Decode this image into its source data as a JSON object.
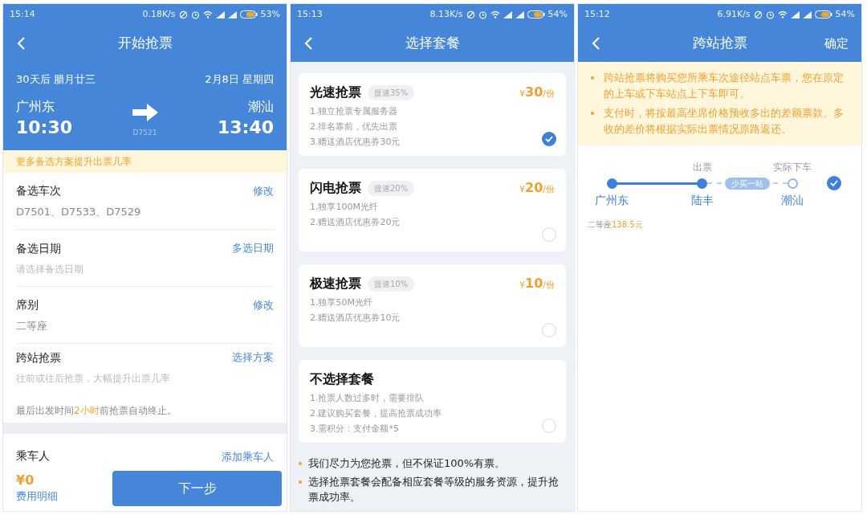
{
  "booking_screen": {
    "status_bar": {
      "time": "15:14",
      "speed": "0.18K/s",
      "battery": "53%"
    },
    "header": {
      "title": "开始抢票"
    },
    "trip": {
      "days_ahead": "30天后 腊月廿三",
      "date": "2月8日 星期四",
      "from": "广州东",
      "depart": "10:30",
      "train": "D7521",
      "to": "潮汕",
      "arrive": "13:40"
    },
    "notice": "更多备选方案提升出票几率",
    "options": [
      {
        "label": "备选车次",
        "action": "修改",
        "value": "D7501、D7533、D7529"
      },
      {
        "label": "备选日期",
        "action": "多选日期",
        "placeholder": "请选择备选日期"
      },
      {
        "label": "席别",
        "action": "修改",
        "value": "二等座"
      },
      {
        "label": "跨站抢票",
        "action": "选择方案",
        "placeholder": "往前或往后抢票，大幅提升出票几率"
      }
    ],
    "deadline_note": "最后出发时间**2小时**前抢票自动终止。",
    "passenger": {
      "label": "乘车人",
      "action": "添加乘车人"
    },
    "footer": {
      "price": "¥0",
      "detail": "费用明细",
      "button": "下一步"
    }
  },
  "package_screen": {
    "status_bar": {
      "time": "15:13",
      "speed": "8.13K/s",
      "battery": "54%"
    },
    "header": {
      "title": "选择套餐"
    },
    "packages": [
      {
        "name": "光速抢票",
        "boost": "提速35%",
        "currency": "¥",
        "amount": "30",
        "unit": "/份",
        "features": [
          "1.独立抢票专属服务器",
          "2.排名靠前，优先出票",
          "3.赠送酒店优惠券30元"
        ],
        "selected": true
      },
      {
        "name": "闪电抢票",
        "boost": "提速20%",
        "currency": "¥",
        "amount": "20",
        "unit": "/份",
        "features": [
          "1.独享100M光纤",
          "2.赠送酒店优惠券20元"
        ],
        "selected": false
      },
      {
        "name": "极速抢票",
        "boost": "提速10%",
        "currency": "¥",
        "amount": "10",
        "unit": "/份",
        "features": [
          "1.独享50M光纤",
          "2.赠送酒店优惠券10元"
        ],
        "selected": false
      },
      {
        "name": "不选择套餐",
        "features": [
          "1.抢票人数过多时，需要排队",
          "2.建议购买套餐，提高抢票成功率",
          "3.需积分：支付金额*5"
        ],
        "selected": false
      }
    ],
    "notes": [
      "我们尽力为您抢票，但不保证100%有票。",
      "选择抢票套餐会配备相应套餐等级的服务资源，提升抢票成功率。"
    ]
  },
  "cross_station_screen": {
    "status_bar": {
      "time": "15:12",
      "speed": "6.91K/s",
      "battery": "54%"
    },
    "header": {
      "title": "跨站抢票",
      "action": "确定"
    },
    "notices": [
      "跨站抢票将购买您所乘车次途径站点车票，您在原定的上车或下车站点上下车即可。",
      "支付时，将按最高坐席价格预收多出的差额票款。多收的差价将根据实际出票情况原路返还。"
    ],
    "route": {
      "stations": [
        {
          "name": "广州东",
          "kind": "filled"
        },
        {
          "name": "陆丰",
          "label": "出票",
          "kind": "filled"
        },
        {
          "name": "潮汕",
          "label": "实际下车",
          "kind": "hollow"
        }
      ],
      "segments": [
        {
          "kind": "solid"
        },
        {
          "kind": "dashed",
          "badge": "少买一站"
        }
      ],
      "selected": true
    },
    "fare": "二等座**138.5元**"
  }
}
